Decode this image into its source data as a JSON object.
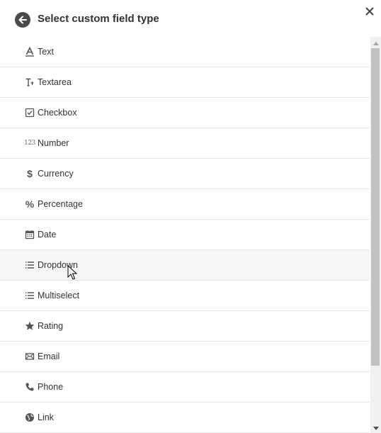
{
  "header": {
    "title": "Select custom field type",
    "back_icon": "arrow-left-circle-icon",
    "close_icon": "close-icon"
  },
  "field_types": [
    {
      "label": "Text",
      "icon": "text-format-icon"
    },
    {
      "label": "Textarea",
      "icon": "textarea-icon"
    },
    {
      "label": "Checkbox",
      "icon": "checkbox-icon"
    },
    {
      "label": "Number",
      "icon": "number-icon"
    },
    {
      "label": "Currency",
      "icon": "dollar-icon"
    },
    {
      "label": "Percentage",
      "icon": "percent-icon"
    },
    {
      "label": "Date",
      "icon": "calendar-icon"
    },
    {
      "label": "Dropdown",
      "icon": "list-icon"
    },
    {
      "label": "Multiselect",
      "icon": "list-icon"
    },
    {
      "label": "Rating",
      "icon": "star-icon"
    },
    {
      "label": "Email",
      "icon": "envelope-icon"
    },
    {
      "label": "Phone",
      "icon": "phone-icon"
    },
    {
      "label": "Link",
      "icon": "globe-icon"
    }
  ],
  "hovered_item": "Dropdown"
}
